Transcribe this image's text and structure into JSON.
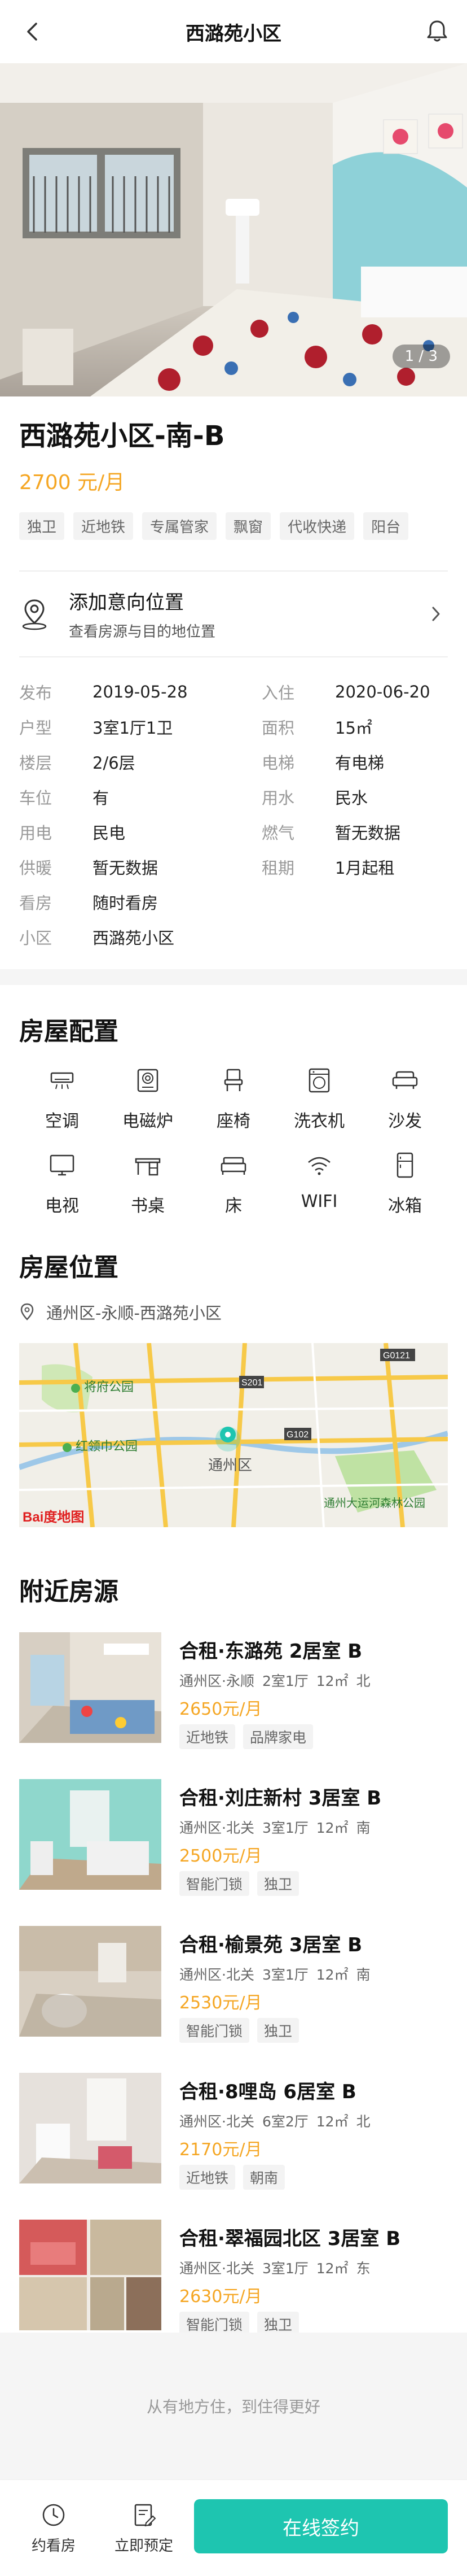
{
  "header": {
    "title": "西潞苑小区"
  },
  "hero": {
    "counter": "1 / 3"
  },
  "listing": {
    "title": "西潞苑小区-南-B",
    "price": "2700 元/月",
    "tags": [
      "独卫",
      "近地铁",
      "专属管家",
      "飘窗",
      "代收快递",
      "阳台"
    ]
  },
  "intent": {
    "title": "添加意向位置",
    "subtitle": "查看房源与目的地位置"
  },
  "attributes": [
    {
      "k": "发布",
      "v": "2019-05-28",
      "k2": "入住",
      "v2": "2020-06-20"
    },
    {
      "k": "户型",
      "v": "3室1厅1卫",
      "k2": "面积",
      "v2": "15㎡"
    },
    {
      "k": "楼层",
      "v": "2/6层",
      "k2": "电梯",
      "v2": "有电梯"
    },
    {
      "k": "车位",
      "v": "有",
      "k2": "用水",
      "v2": "民水"
    },
    {
      "k": "用电",
      "v": "民电",
      "k2": "燃气",
      "v2": "暂无数据"
    },
    {
      "k": "供暖",
      "v": "暂无数据",
      "k2": "租期",
      "v2": "1月起租"
    },
    {
      "k": "看房",
      "v": "随时看房",
      "k2": "",
      "v2": ""
    },
    {
      "k": "小区",
      "v": "西潞苑小区",
      "k2": "",
      "v2": ""
    }
  ],
  "amenities": {
    "title": "房屋配置",
    "items": [
      {
        "label": "空调",
        "icon": "air-conditioner-icon"
      },
      {
        "label": "电磁炉",
        "icon": "induction-cooker-icon"
      },
      {
        "label": "座椅",
        "icon": "chair-icon"
      },
      {
        "label": "洗衣机",
        "icon": "washing-machine-icon"
      },
      {
        "label": "沙发",
        "icon": "sofa-icon"
      },
      {
        "label": "电视",
        "icon": "tv-icon"
      },
      {
        "label": "书桌",
        "icon": "desk-icon"
      },
      {
        "label": "床",
        "icon": "bed-icon"
      },
      {
        "label": "WIFI",
        "icon": "wifi-icon"
      },
      {
        "label": "冰箱",
        "icon": "fridge-icon"
      }
    ]
  },
  "location": {
    "title": "房屋位置",
    "address": "通州区-永顺-西潞苑小区",
    "map_labels": {
      "park1": "将府公园",
      "park2": "红领巾公园",
      "district": "通州区",
      "forest": "通州大运河森林公园",
      "road1": "S201",
      "road2": "G102",
      "road3": "G0121",
      "brand": "Bai度地图"
    }
  },
  "nearby": {
    "title": "附近房源",
    "items": [
      {
        "title": "合租·东潞苑 2居室 B",
        "area": "通州区·永顺",
        "layout": "2室1厅",
        "size": "12㎡",
        "dir": "北",
        "price": "2650元/月",
        "tags": [
          "近地铁",
          "品牌家电"
        ]
      },
      {
        "title": "合租·刘庄新村 3居室 B",
        "area": "通州区·北关",
        "layout": "3室1厅",
        "size": "12㎡",
        "dir": "南",
        "price": "2500元/月",
        "tags": [
          "智能门锁",
          "独卫"
        ]
      },
      {
        "title": "合租·榆景苑 3居室 B",
        "area": "通州区·北关",
        "layout": "3室1厅",
        "size": "12㎡",
        "dir": "南",
        "price": "2530元/月",
        "tags": [
          "智能门锁",
          "独卫"
        ]
      },
      {
        "title": "合租·8哩岛 6居室 B",
        "area": "通州区·北关",
        "layout": "6室2厅",
        "size": "12㎡",
        "dir": "北",
        "price": "2170元/月",
        "tags": [
          "近地铁",
          "朝南"
        ]
      },
      {
        "title": "合租·翠福园北区 3居室 B",
        "area": "通州区·北关",
        "layout": "3室1厅",
        "size": "12㎡",
        "dir": "东",
        "price": "2630元/月",
        "tags": [
          "智能门锁",
          "独卫"
        ]
      }
    ]
  },
  "footer_slogan": "从有地方住，到住得更好",
  "bottom_bar": {
    "viewing": "约看房",
    "reserve": "立即预定",
    "sign": "在线签约"
  },
  "colors": {
    "accent": "#1ec5b0",
    "price": "#f5a623"
  }
}
